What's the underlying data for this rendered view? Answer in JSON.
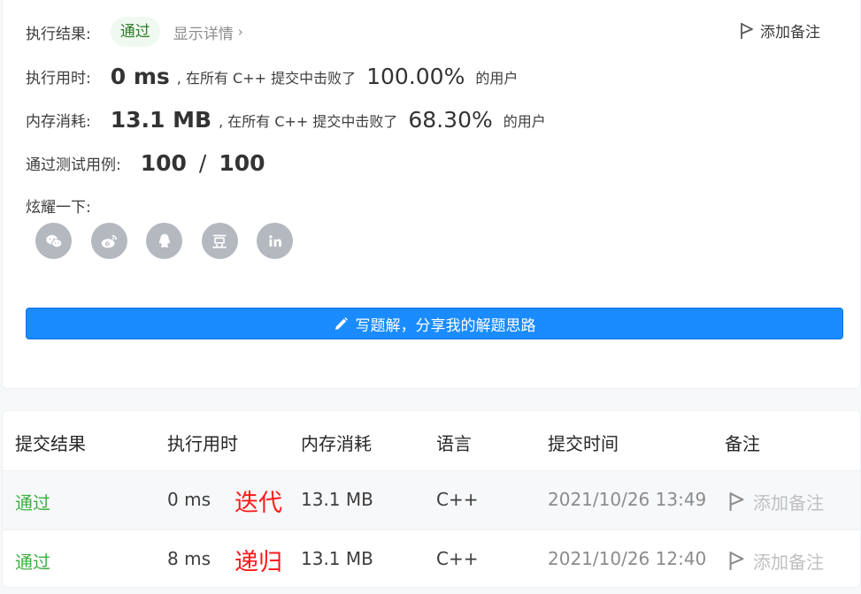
{
  "result": {
    "label": "执行结果:",
    "status": "通过",
    "details_link": "显示详情",
    "add_note": "添加备注"
  },
  "runtime": {
    "label": "执行用时:",
    "value": "0 ms",
    "prefix": ", 在所有 C++ 提交中击败了",
    "percent": "100.00%",
    "suffix": "的用户"
  },
  "memory": {
    "label": "内存消耗:",
    "value": "13.1 MB",
    "prefix": ", 在所有 C++ 提交中击败了",
    "percent": "68.30%",
    "suffix": "的用户"
  },
  "testcases": {
    "label": "通过测试用例:",
    "passed": "100",
    "sep": "/",
    "total": "100"
  },
  "share": {
    "label": "炫耀一下:",
    "icons": [
      "wechat-icon",
      "weibo-icon",
      "qq-icon",
      "douban-icon",
      "linkedin-icon"
    ]
  },
  "write_button": "写题解，分享我的解题思路",
  "table": {
    "headers": [
      "提交结果",
      "执行用时",
      "内存消耗",
      "语言",
      "提交时间",
      "备注"
    ],
    "rows": [
      {
        "status": "通过",
        "runtime": "0 ms",
        "annotation": "迭代",
        "memory": "13.1 MB",
        "language": "C++",
        "time": "2021/10/26 13:49",
        "note": "添加备注"
      },
      {
        "status": "通过",
        "runtime": "8 ms",
        "annotation": "递归",
        "memory": "13.1 MB",
        "language": "C++",
        "time": "2021/10/26 12:40",
        "note": "添加备注"
      }
    ]
  },
  "colors": {
    "accent": "#1a8cff",
    "pass": "#3eaf3e",
    "annotation": "#ff1a1a"
  }
}
